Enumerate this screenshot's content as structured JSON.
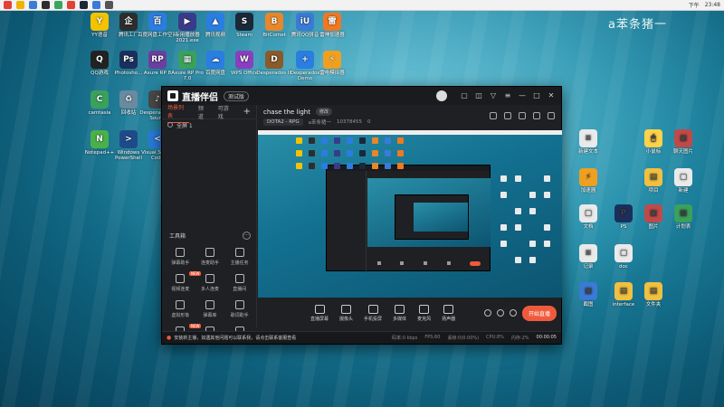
{
  "watermark": "a苯条猪一",
  "taskbar": {
    "icons": [
      {
        "name": "chrome-icon",
        "color": "#e34133"
      },
      {
        "name": "folder-icon",
        "color": "#f0b400"
      },
      {
        "name": "app-icon",
        "color": "#3a7bd5"
      },
      {
        "name": "app-icon-2",
        "color": "#2d2d2d"
      },
      {
        "name": "app-icon-3",
        "color": "#3ba55c"
      },
      {
        "name": "app-icon-4",
        "color": "#e34133"
      },
      {
        "name": "steam-icon",
        "color": "#1b2838"
      },
      {
        "name": "app-icon-5",
        "color": "#3a7bd5"
      },
      {
        "name": "app-icon-6",
        "color": "#555555"
      }
    ],
    "time": "23:48",
    "date": "下午"
  },
  "desktop_icons": [
    {
      "label": "YY语音",
      "glyph": "Y",
      "color": "#f5c200"
    },
    {
      "label": "腾讯工厂",
      "glyph": "企",
      "color": "#2d2d2d"
    },
    {
      "label": "百度网盘工作空间",
      "glyph": "百",
      "color": "#2a7de1"
    },
    {
      "label": "专用播放器2021.exe",
      "glyph": "▶",
      "color": "#3a3a8a"
    },
    {
      "label": "腾讯视频",
      "glyph": "▲",
      "color": "#2a7de1"
    },
    {
      "label": "Steam",
      "glyph": "S",
      "color": "#1b2838"
    },
    {
      "label": "BitComet",
      "glyph": "B",
      "color": "#e8862a"
    },
    {
      "label": "腾讯QQ拼音",
      "glyph": "iU",
      "color": "#3a7bd5"
    },
    {
      "label": "雷神加速器",
      "glyph": "雷",
      "color": "#f07820"
    },
    {
      "label": "QQ游戏",
      "glyph": "Q",
      "color": "#222"
    },
    {
      "label": "Photosho...",
      "glyph": "Ps",
      "color": "#1c2f5c"
    },
    {
      "label": "Axure RP 8",
      "glyph": "RP",
      "color": "#6b3fa0"
    },
    {
      "label": "Axure RP Pro 7.0",
      "glyph": "▦",
      "color": "#3aa05c"
    },
    {
      "label": "百度网盘",
      "glyph": "☁",
      "color": "#2a7de1"
    },
    {
      "label": "WPS Office",
      "glyph": "W",
      "color": "#8a3fc0"
    },
    {
      "label": "Desperados III",
      "glyph": "D",
      "color": "#8a5a2a"
    },
    {
      "label": "Desperados Demo",
      "glyph": "+",
      "color": "#2a7de1"
    },
    {
      "label": "雷电模拟器",
      "glyph": "⚡",
      "color": "#f0a020"
    },
    {
      "label": "camtasia",
      "glyph": "C",
      "color": "#3aa05c"
    },
    {
      "label": "回收站",
      "glyph": "♻",
      "color": "#6a8aa0"
    },
    {
      "label": "Desperados III Sound",
      "glyph": "♪",
      "color": "#4a4a4a"
    },
    {
      "label": "Notepad++",
      "glyph": "N",
      "color": "#4ab04a"
    },
    {
      "label": "Windows PowerShell",
      "glyph": ">",
      "color": "#1f4a8a"
    },
    {
      "label": "Visual Studio Code",
      "glyph": "<",
      "color": "#2a7de1"
    }
  ],
  "right_icons": [
    {
      "label": "新建文本",
      "glyph": "≡",
      "color": "#eaeaea"
    },
    {
      "label": "小鼠标",
      "glyph": "🖱",
      "color": "#ffd24a"
    },
    {
      "label": "聊天图片",
      "glyph": "▣",
      "color": "#c04a4a"
    },
    {
      "label": "加速器",
      "glyph": "⚡",
      "color": "#f0a020"
    },
    {
      "label": "项目",
      "glyph": "▤",
      "color": "#f0c040"
    },
    {
      "label": "新建",
      "glyph": "▢",
      "color": "#eaeaea"
    },
    {
      "label": "文档",
      "glyph": "▢",
      "color": "#eaeaea"
    },
    {
      "label": "PS",
      "glyph": "P",
      "color": "#1c2f5c"
    },
    {
      "label": "图片",
      "glyph": "▣",
      "color": "#c04a4a"
    },
    {
      "label": "计划表",
      "glyph": "▦",
      "color": "#3aa05c"
    },
    {
      "label": "记录",
      "glyph": "≡",
      "color": "#eaeaea"
    },
    {
      "label": "doc",
      "glyph": "▢",
      "color": "#eaeaea"
    },
    {
      "label": "截图",
      "glyph": "▣",
      "color": "#3a7bd5"
    },
    {
      "label": "interface",
      "glyph": "▤",
      "color": "#f0c040"
    },
    {
      "label": "文件夹",
      "glyph": "▤",
      "color": "#f0c040"
    }
  ],
  "app": {
    "name": "直播伴侣",
    "badge": "测试版",
    "title_controls": [
      "▢",
      "◫",
      "▽",
      "≡",
      "—",
      "□",
      "✕"
    ],
    "tabs": [
      "场景列表",
      "频道",
      "可游戏"
    ],
    "scene": "全屏 1",
    "tools_title": "工具箱",
    "tools": [
      {
        "label": "弹幕助手",
        "new": false
      },
      {
        "label": "连麦助手",
        "new": false
      },
      {
        "label": "主播任务",
        "new": false
      },
      {
        "label": "视频连麦",
        "new": true
      },
      {
        "label": "多人连麦",
        "new": false
      },
      {
        "label": "直播间",
        "new": false
      },
      {
        "label": "虚拟形象",
        "new": false
      },
      {
        "label": "弹幕库",
        "new": false
      },
      {
        "label": "歌词助手",
        "new": false
      },
      {
        "label": "美颜特效",
        "new": true
      },
      {
        "label": "录制",
        "new": false
      },
      {
        "label": "分享",
        "new": false
      }
    ],
    "stream_title": "chase the light",
    "stream_pill": "修改",
    "category": "DOTA2 - RPG",
    "streamer": "a苯条猪一",
    "room_id": "10378455",
    "likes": "0",
    "controls": [
      "直播屏幕",
      "摄像头",
      "手机投屏",
      "多媒体",
      "麦克风",
      "扬声器"
    ],
    "go_live": "开始直播",
    "status_warning": "安装新主播，如遇其他问题可以联系我，请点击联系客服查看",
    "stats": [
      "码率:0 kbps",
      "FPS:60",
      "丢帧:0(0.00%)",
      "CPU:8%",
      "内存:2%"
    ],
    "timer": "00:00:05"
  }
}
